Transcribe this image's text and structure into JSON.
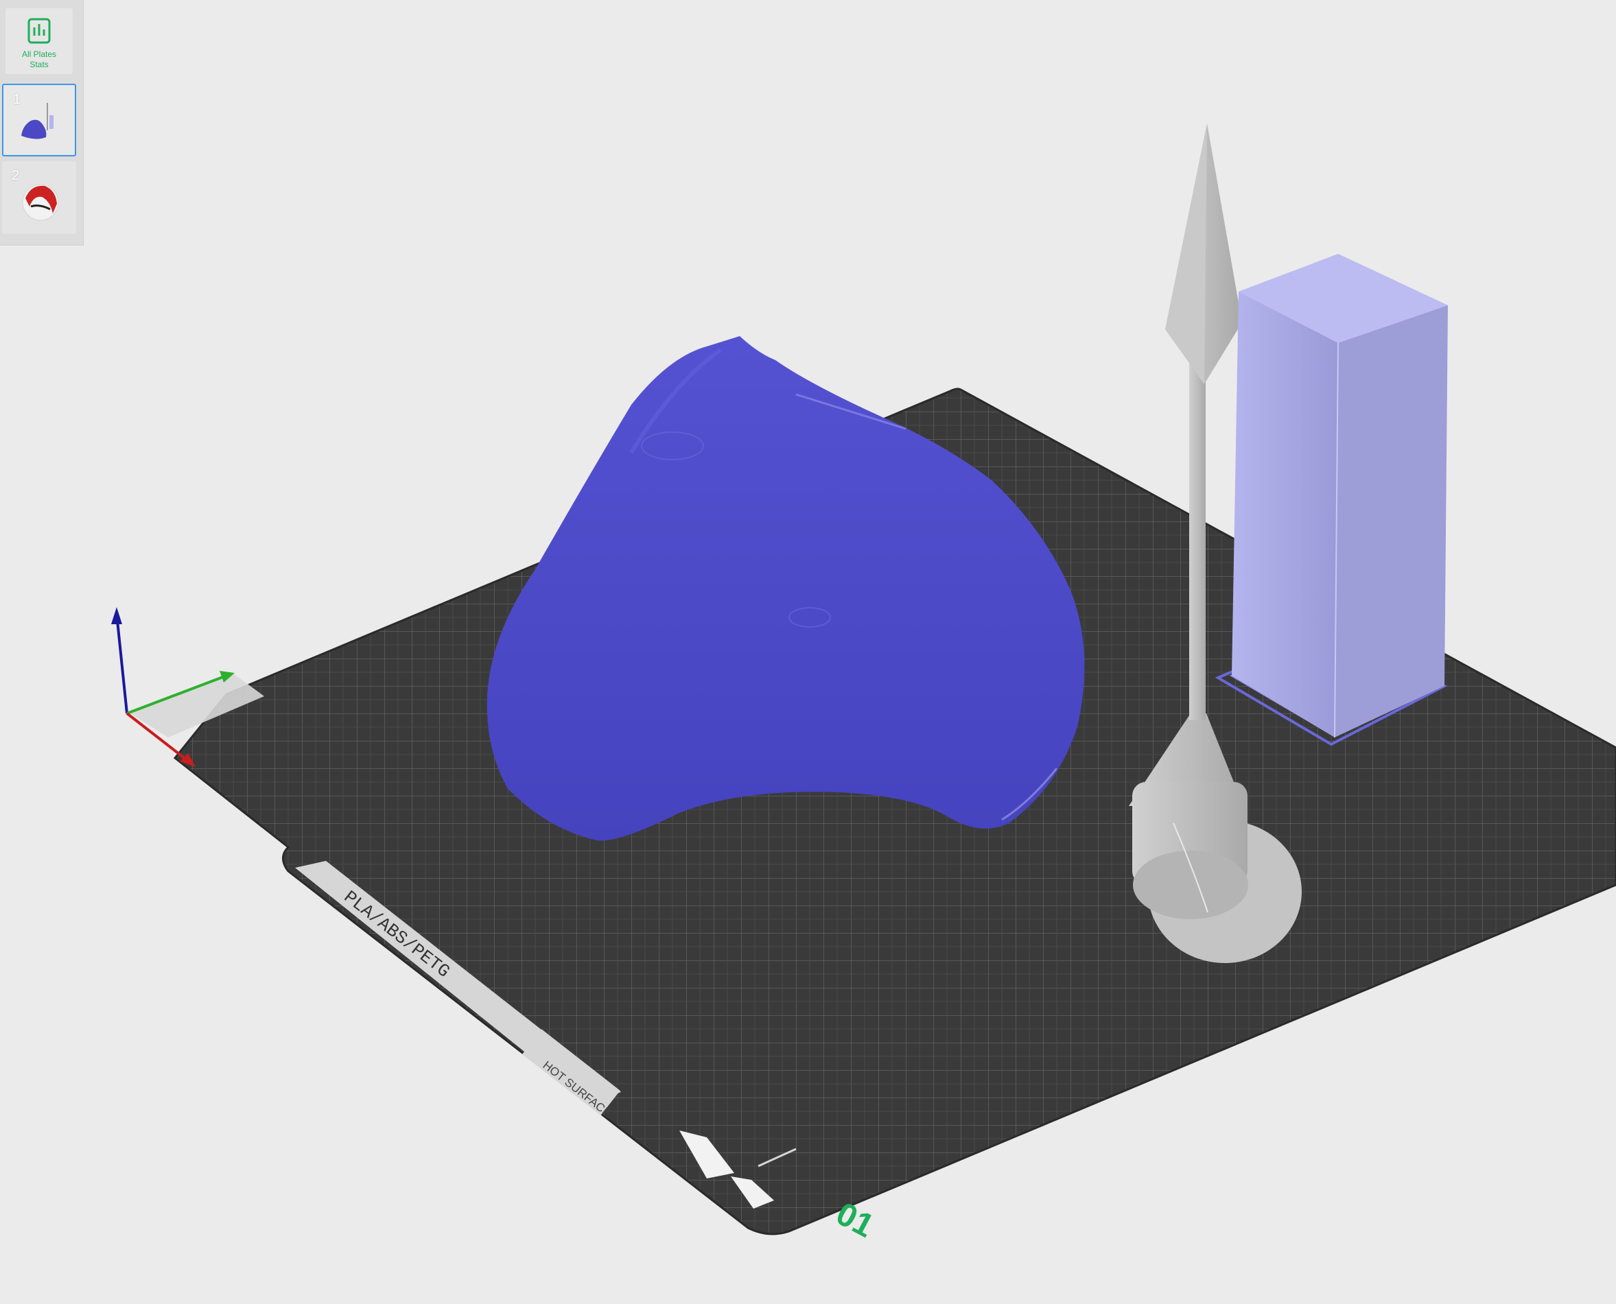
{
  "sidebar": {
    "stats_button": {
      "label": "All Plates\nStats",
      "icon": "bar-chart-icon"
    },
    "plates": [
      {
        "number": "1",
        "selected": true
      },
      {
        "number": "2",
        "selected": false
      }
    ]
  },
  "build_plate": {
    "plate_number": "01",
    "brand_label": "PLA/ABS/PETG",
    "warning_label": "HOT SURFACE"
  },
  "colors": {
    "background": "#ebebeb",
    "plate": "#3a3a3a",
    "model_blue": "#4a48c4",
    "model_gray": "#bdbdbd",
    "tower": "#a8a8e6",
    "plate_number": "#1fae5a",
    "selection_border": "#3f95e8"
  }
}
